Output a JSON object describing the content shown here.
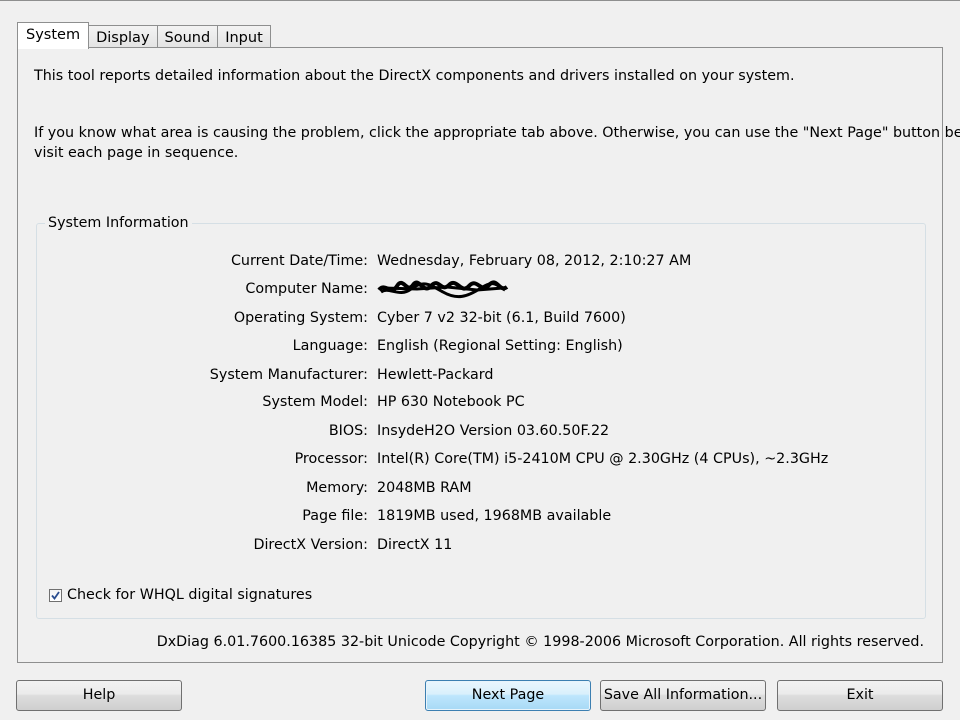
{
  "tabs": [
    {
      "label": "System",
      "active": true
    },
    {
      "label": "Display",
      "active": false
    },
    {
      "label": "Sound",
      "active": false
    },
    {
      "label": "Input",
      "active": false
    }
  ],
  "intro": {
    "line1": "This tool reports detailed information about the DirectX components and drivers installed on your system.",
    "line2": "If you know what area is causing the problem, click the appropriate tab above.  Otherwise, you can use the \"Next Page\" button below to",
    "line3": "visit each page in sequence."
  },
  "system_info": {
    "title": "System Information",
    "rows": [
      {
        "label": "Current Date/Time:",
        "value": "Wednesday, February 08, 2012, 2:10:27 AM"
      },
      {
        "label": "Computer Name:",
        "value": "",
        "redacted": true
      },
      {
        "label": "Operating System:",
        "value": "Cyber 7 v2 32-bit (6.1, Build 7600)"
      },
      {
        "label": "Language:",
        "value": "English (Regional Setting: English)"
      },
      {
        "label": "System Manufacturer:",
        "value": "Hewlett-Packard"
      },
      {
        "label": "System Model:",
        "value": "HP 630 Notebook PC"
      },
      {
        "label": "BIOS:",
        "value": "InsydeH2O Version 03.60.50F.22"
      },
      {
        "label": "Processor:",
        "value": "Intel(R) Core(TM) i5-2410M CPU @ 2.30GHz (4 CPUs), ~2.3GHz"
      },
      {
        "label": "Memory:",
        "value": "2048MB RAM"
      },
      {
        "label": "Page file:",
        "value": "1819MB used, 1968MB available"
      },
      {
        "label": "DirectX Version:",
        "value": "DirectX 11"
      }
    ],
    "whql_label": "Check for WHQL digital signatures",
    "whql_checked": true
  },
  "copyright": "DxDiag 6.01.7600.16385 32-bit Unicode  Copyright © 1998-2006 Microsoft Corporation.  All rights reserved.",
  "buttons": {
    "help": "Help",
    "next_page": "Next Page",
    "save_all": "Save All Information...",
    "exit": "Exit"
  },
  "colors": {
    "window_bg": "#f0f0f0",
    "border": "#8e8f8f",
    "default_button_border": "#3c7fb1"
  }
}
